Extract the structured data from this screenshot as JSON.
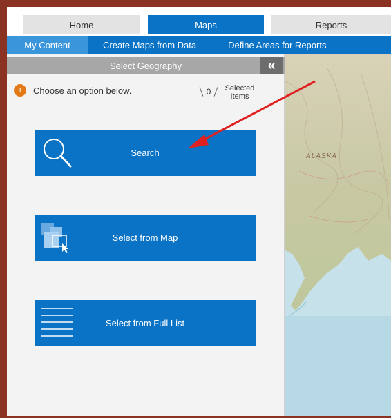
{
  "nav": {
    "tabs": [
      {
        "label": "Home"
      },
      {
        "label": "Maps"
      },
      {
        "label": "Reports"
      }
    ],
    "subnav": [
      {
        "label": "My Content"
      },
      {
        "label": "Create Maps from Data"
      },
      {
        "label": "Define Areas for Reports"
      }
    ]
  },
  "panel": {
    "header": "Select Geography",
    "collapse_glyph": "«",
    "step_number": "1",
    "instruction": "Choose an option below.",
    "selected_count": "0",
    "selected_label": "Selected Items",
    "buttons": [
      {
        "label": "Search",
        "icon": "search-icon"
      },
      {
        "label": "Select from Map",
        "icon": "map-select-icon"
      },
      {
        "label": "Select from Full List",
        "icon": "list-icon"
      }
    ]
  },
  "map": {
    "region_label": "ALASKA"
  },
  "colors": {
    "brand_blue": "#0a73c6",
    "active_subtab": "#3b95db",
    "step_badge": "#e27b17",
    "frame": "#8b3322",
    "annotation_arrow": "#e02020"
  }
}
